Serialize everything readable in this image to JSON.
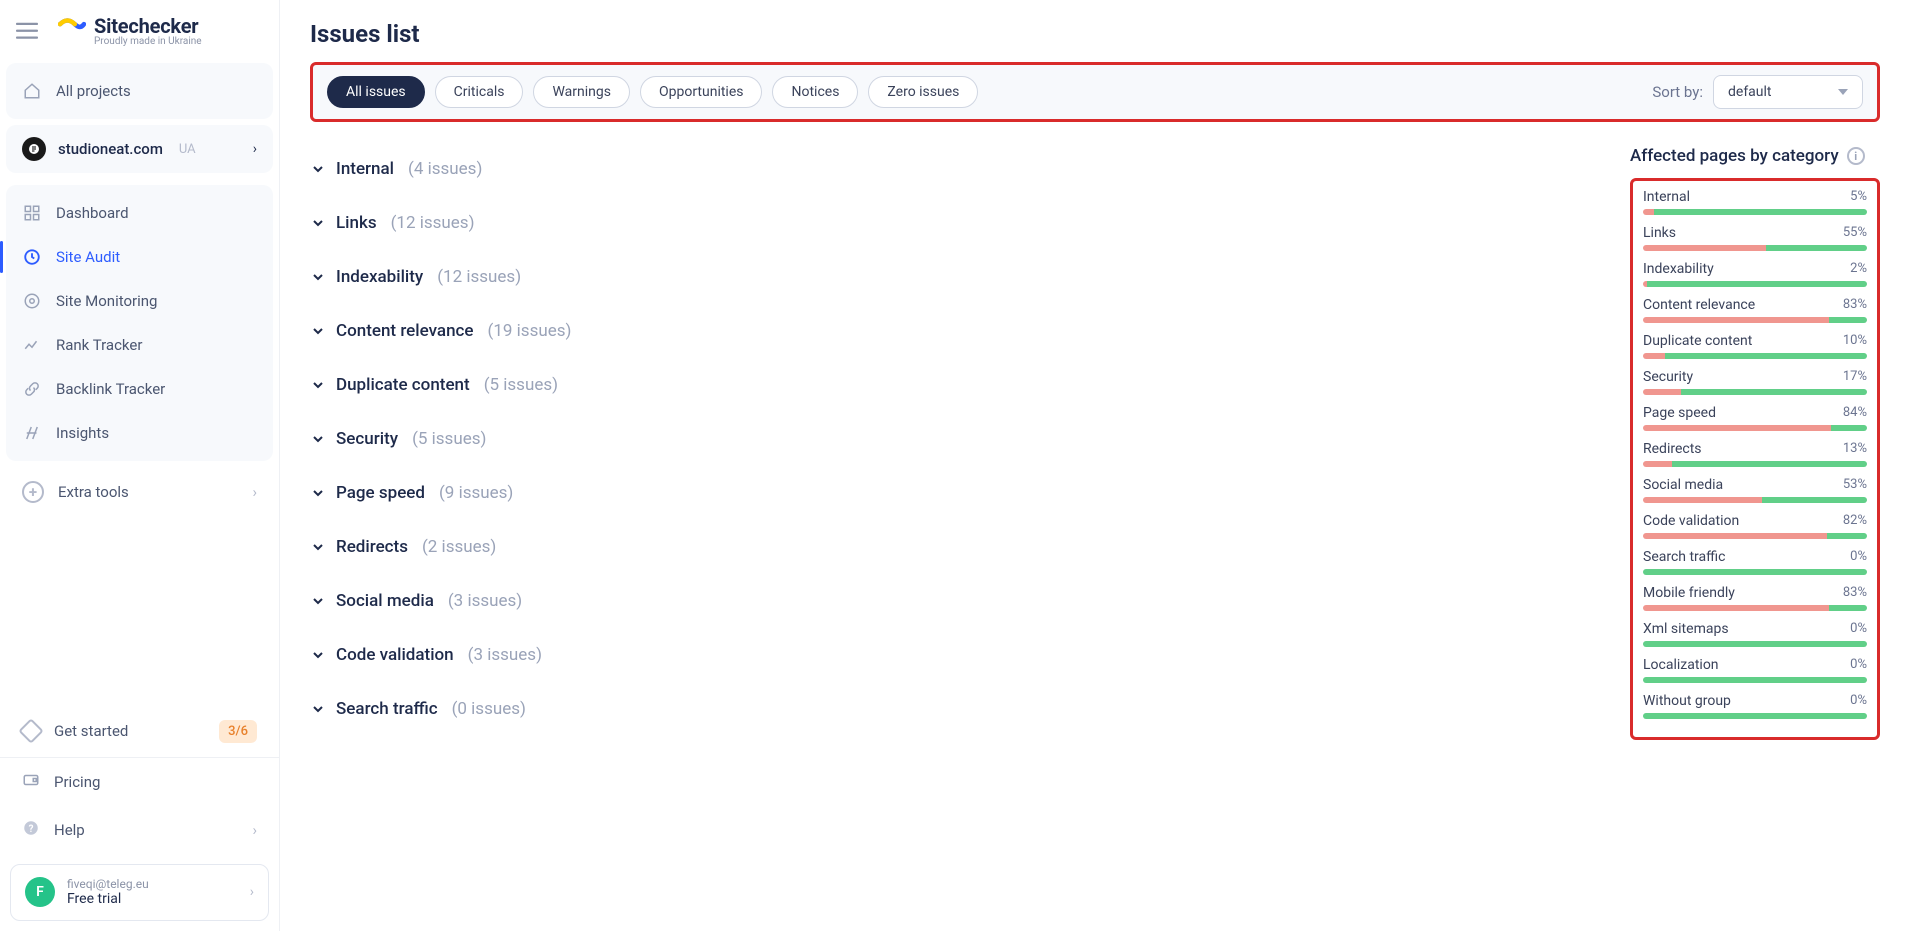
{
  "brand": {
    "name": "Sitechecker",
    "tagline": "Proudly made in Ukraine"
  },
  "sidebar": {
    "all_projects": "All projects",
    "project": {
      "name": "studioneat.com",
      "country": "UA"
    },
    "items": [
      "Dashboard",
      "Site Audit",
      "Site Monitoring",
      "Rank Tracker",
      "Backlink Tracker",
      "Insights"
    ],
    "active": 1,
    "extra_tools": "Extra tools",
    "get_started": "Get started",
    "get_started_badge": "3/6",
    "pricing": "Pricing",
    "help": "Help",
    "user": {
      "initial": "F",
      "email": "fiveqi@teleg.eu",
      "plan": "Free trial"
    }
  },
  "page": {
    "title": "Issues list",
    "filters": [
      "All issues",
      "Criticals",
      "Warnings",
      "Opportunities",
      "Notices",
      "Zero issues"
    ],
    "active_filter": 0,
    "sort_label": "Sort by:",
    "sort_value": "default"
  },
  "issues": [
    {
      "name": "Internal",
      "count": 4
    },
    {
      "name": "Links",
      "count": 12
    },
    {
      "name": "Indexability",
      "count": 12
    },
    {
      "name": "Content relevance",
      "count": 19
    },
    {
      "name": "Duplicate content",
      "count": 5
    },
    {
      "name": "Security",
      "count": 5
    },
    {
      "name": "Page speed",
      "count": 9
    },
    {
      "name": "Redirects",
      "count": 2
    },
    {
      "name": "Social media",
      "count": 3
    },
    {
      "name": "Code validation",
      "count": 3
    },
    {
      "name": "Search traffic",
      "count": 0
    }
  ],
  "affected": {
    "title": "Affected pages by category",
    "categories": [
      {
        "name": "Internal",
        "pct": 5
      },
      {
        "name": "Links",
        "pct": 55
      },
      {
        "name": "Indexability",
        "pct": 2
      },
      {
        "name": "Content relevance",
        "pct": 83
      },
      {
        "name": "Duplicate content",
        "pct": 10
      },
      {
        "name": "Security",
        "pct": 17
      },
      {
        "name": "Page speed",
        "pct": 84
      },
      {
        "name": "Redirects",
        "pct": 13
      },
      {
        "name": "Social media",
        "pct": 53
      },
      {
        "name": "Code validation",
        "pct": 82
      },
      {
        "name": "Search traffic",
        "pct": 0
      },
      {
        "name": "Mobile friendly",
        "pct": 83
      },
      {
        "name": "Xml sitemaps",
        "pct": 0
      },
      {
        "name": "Localization",
        "pct": 0
      },
      {
        "name": "Without group",
        "pct": 0
      }
    ]
  }
}
